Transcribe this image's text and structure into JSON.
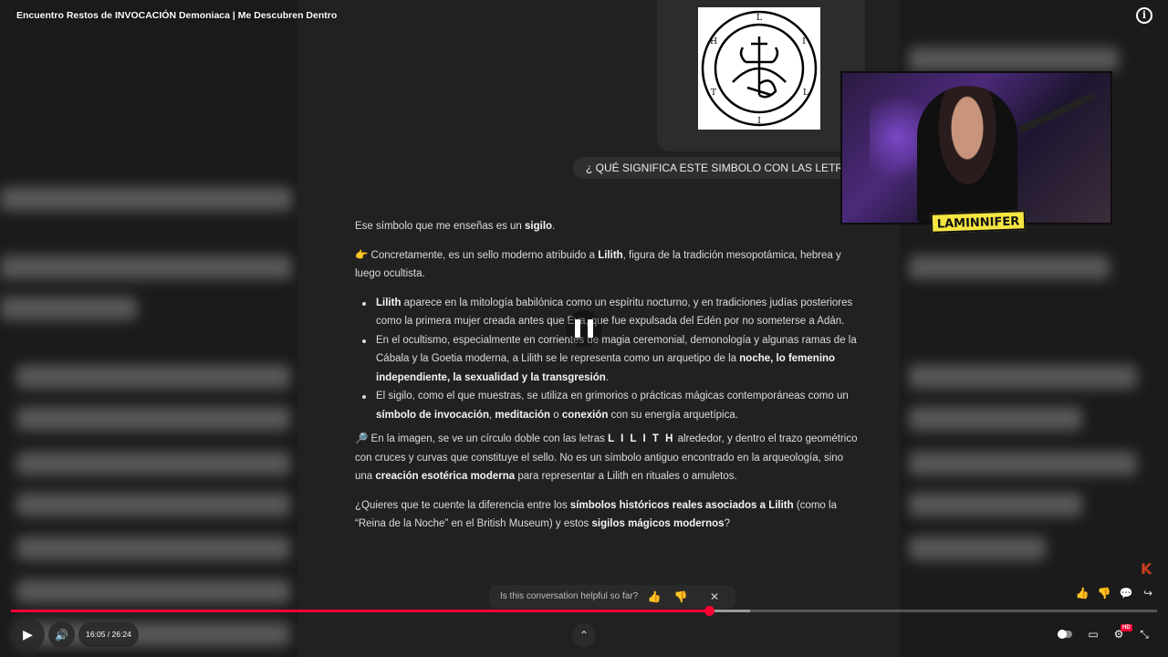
{
  "video": {
    "title": "Encuentro Restos de INVOCACIÓN Demoniaca | Me Descubren Dentro",
    "current_time": "16:05",
    "duration": "26:24",
    "time_display": "16:05 / 26:24",
    "progress_fraction": 0.609,
    "buffer_fraction": 0.645,
    "hd_badge": "HD"
  },
  "chat": {
    "user_message": "¿ QUÉ SIGNIFICA ESTE SIMBOLO CON LAS LETRAS LILIT",
    "sigil_letters": [
      "L",
      "I",
      "L",
      "I",
      "T",
      "H"
    ],
    "answer": {
      "p1_a": "Ese símbolo que me enseñas es un ",
      "p1_b": "sigilo",
      "p1_c": ".",
      "p2_emoji": "👉",
      "p2_a": " Concretamente, es un sello moderno atribuido a ",
      "p2_b": "Lilith",
      "p2_c": ", figura de la tradición mesopotámica, hebrea y luego ocultista.",
      "li1_a": "Lilith",
      "li1_b": " aparece en la mitología babilónica como un espíritu nocturno, y en tradiciones judías posteriores como la primera mujer creada antes que Eva, que fue expulsada del Edén por no someterse a Adán.",
      "li2_a": "En el ocultismo, especialmente en corrientes de magia ceremonial, demonología y algunas ramas de la Cábala y la Goetia moderna, a Lilith se le representa como un arquetipo de la ",
      "li2_b": "noche, lo femenino independiente, la sexualidad y la transgresión",
      "li2_c": ".",
      "li3_a": "El sigilo, como el que muestras, se utiliza en grimorios o prácticas mágicas contemporáneas como un ",
      "li3_b": "símbolo de invocación",
      "li3_c": ", ",
      "li3_d": "meditación",
      "li3_e": " o ",
      "li3_f": "conexión",
      "li3_g": " con su energía arquetípica.",
      "p3_emoji": "🔎",
      "p3_a": " En la imagen, se ve un círculo doble con las letras ",
      "p3_b": "L I L I T H",
      "p3_c": " alrededor, y dentro el trazo geométrico con cruces y curvas que constituye el sello. No es un símbolo antiguo encontrado en la arqueología, sino una ",
      "p3_d": "creación esotérica moderna",
      "p3_e": " para representar a Lilith en rituales o amuletos.",
      "p4_a": "¿Quieres que te cuente la diferencia entre los ",
      "p4_b": "símbolos históricos reales asociados a Lilith",
      "p4_c": " (como la “Reina de la Noche” en el British Museum) y estos ",
      "p4_d": "sigilos mágicos modernos",
      "p4_e": "?"
    },
    "feedback": {
      "question": "Is this conversation helpful so far?",
      "thumbs_up": "👍",
      "thumbs_down": "👎",
      "close": "✕"
    }
  },
  "overlay": {
    "streamer_tag": "LAMINNIFER",
    "channel_logo": "K"
  },
  "icons": {
    "info": "i",
    "play": "▶",
    "volume": "🔊",
    "chevron_up": "⌃",
    "like": "👍",
    "dislike": "👎",
    "comment": "💬",
    "share": "↪",
    "subtitles": "▭",
    "settings": "⚙",
    "fullscreen_exit": "⤡"
  },
  "colors": {
    "progress": "#ff0033",
    "chat_bg": "#212121",
    "user_bubble": "#2f2f2f"
  }
}
